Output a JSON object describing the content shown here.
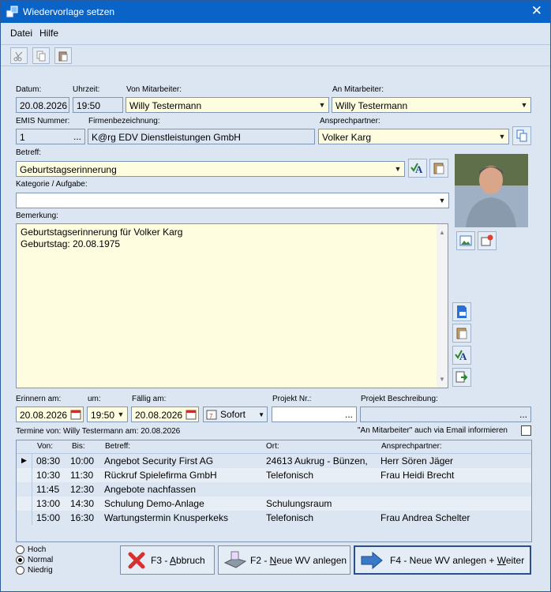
{
  "window": {
    "title": "Wiedervorlage setzen"
  },
  "menu": {
    "items": [
      "Datei",
      "Hilfe"
    ]
  },
  "form": {
    "datum_label": "Datum:",
    "datum_value": "20.08.2026",
    "uhrzeit_label": "Uhrzeit:",
    "uhrzeit_value": "19:50",
    "von_label": "Von Mitarbeiter:",
    "von_value": "Willy Testermann",
    "an_label": "An Mitarbeiter:",
    "an_value": "Willy Testermann",
    "emis_label": "EMIS Nummer:",
    "emis_value": "1",
    "firma_label": "Firmenbezeichnung:",
    "firma_value": "K@rg EDV Dienstleistungen GmbH",
    "ansprech_label": "Ansprechpartner:",
    "ansprech_value": "Volker Karg",
    "betreff_label": "Betreff:",
    "betreff_value": "Geburtstagserinnerung",
    "kategorie_label": "Kategorie / Aufgabe:",
    "kategorie_value": "",
    "bemerkung_label": "Bemerkung:",
    "bemerkung_lines": [
      "Geburtstagserinnerung für Volker Karg",
      "Geburtstag: 20.08.1975"
    ],
    "erinnern_label": "Erinnern am:",
    "erinnern_value": "20.08.2026",
    "um_label": "um:",
    "um_value": "19:50",
    "faellig_label": "Fällig am:",
    "faellig_value": "20.08.2026",
    "sofort_label": "Sofort",
    "projekt_label": "Projekt Nr.:",
    "projekt_value": "",
    "projekt_beschr_label": "Projekt Beschreibung:",
    "projekt_beschr_value": "",
    "termine_text": "Termine von: Willy Testermann am: 20.08.2026",
    "email_info_label": "\"An Mitarbeiter\" auch via Email informieren",
    "dots": "..."
  },
  "table": {
    "headers": [
      "Von:",
      "Bis:",
      "Betreff:",
      "Ort:",
      "Ansprechpartner:"
    ],
    "rows": [
      [
        "08:30",
        "10:00",
        "Angebot Security First AG",
        "24613 Aukrug - Bünzen,",
        "Herr Sören Jäger"
      ],
      [
        "10:30",
        "11:30",
        "Rückruf Spielefirma GmbH",
        "Telefonisch",
        "Frau Heidi Brecht"
      ],
      [
        "11:45",
        "12:30",
        "Angebote nachfassen",
        "",
        ""
      ],
      [
        "13:00",
        "14:30",
        "Schulung Demo-Anlage",
        "Schulungsraum",
        ""
      ],
      [
        "15:00",
        "16:30",
        "Wartungstermin Knusperkeks",
        "Telefonisch",
        "Frau Andrea Schelter"
      ]
    ]
  },
  "priority": {
    "options": [
      "Hoch",
      "Normal",
      "Niedrig"
    ],
    "selected": "Normal"
  },
  "buttons": {
    "abbruch": {
      "prefix": "F3 - ",
      "key": "A",
      "rest": "bbruch"
    },
    "neu": {
      "prefix": "F2 - ",
      "key": "N",
      "rest": "eue WV anlegen"
    },
    "weiter": {
      "prefix": "F4 - Neue WV anlegen + ",
      "key": "W",
      "rest": "eiter"
    }
  }
}
